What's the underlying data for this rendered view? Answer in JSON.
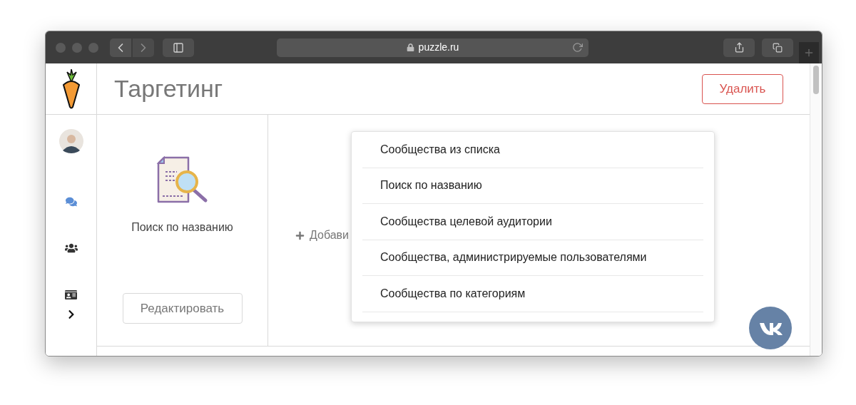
{
  "browser": {
    "url": "puzzle.ru"
  },
  "header": {
    "title": "Таргетинг",
    "delete_button": "Удалить"
  },
  "sidebar": {
    "items": [
      {
        "kind": "chat",
        "selected": true
      },
      {
        "kind": "users",
        "selected": false
      },
      {
        "kind": "card",
        "selected": false
      }
    ]
  },
  "panel": {
    "label": "Поиск по названию",
    "edit_button": "Редактировать"
  },
  "add_link": "Добави",
  "dropdown": {
    "items": [
      "Сообщества из списка",
      "Поиск по названию",
      "Сообщества целевой аудитории",
      "Сообщества, администрируемые пользователями",
      "Сообщества по категориям"
    ]
  }
}
